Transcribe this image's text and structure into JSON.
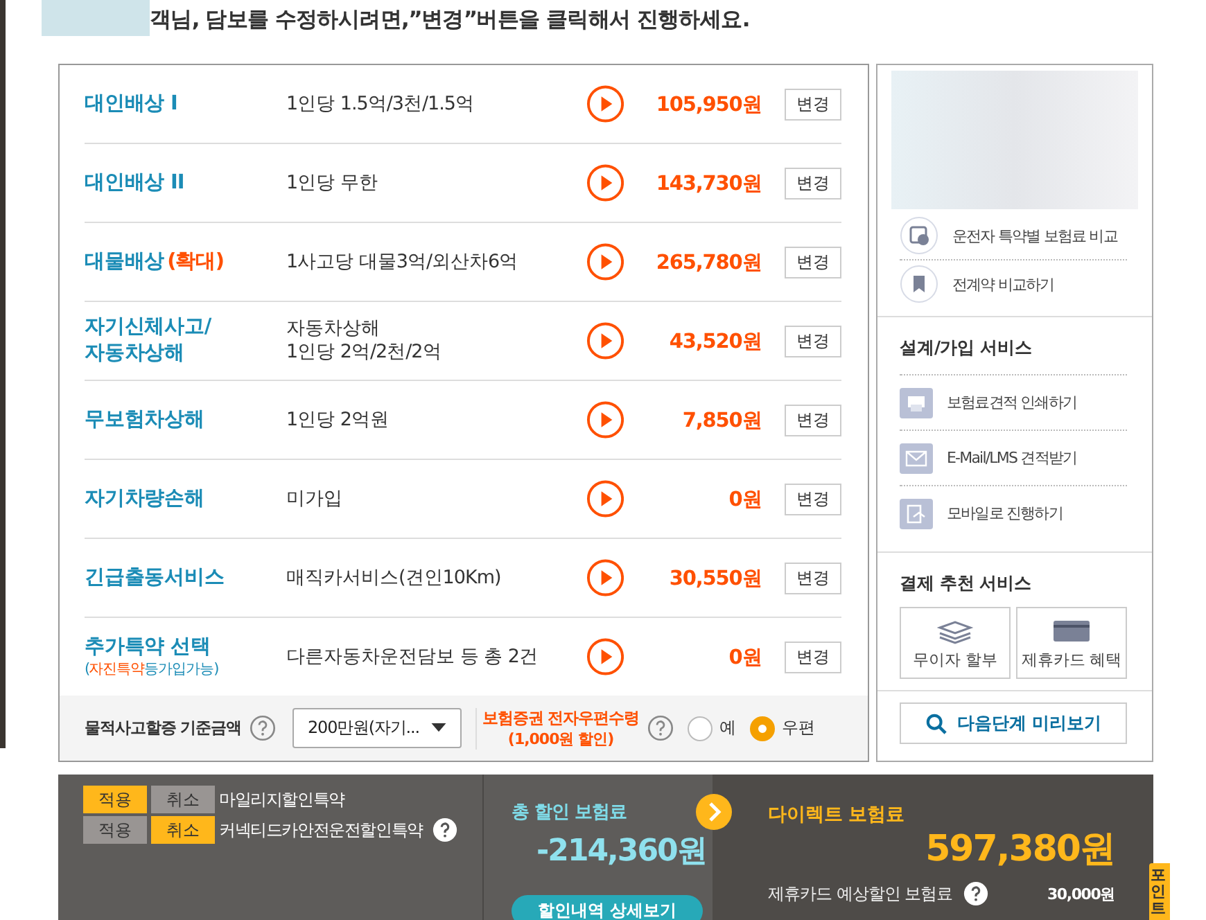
{
  "notice": "객님, 담보를 수정하시려면,”변경”버튼을 클릭해서 진행하세요.",
  "coverages": [
    {
      "label": "대인배상 I",
      "detail": [
        "1인당 1.5억/3천/1.5억"
      ],
      "amount": "105,950원",
      "button": "변경"
    },
    {
      "label": "대인배상 II",
      "detail": [
        "1인당 무한"
      ],
      "amount": "143,730원",
      "button": "변경"
    },
    {
      "label": "대물배상",
      "tag": "(확대)",
      "detail": [
        "1사고당 대물3억/외산차6억"
      ],
      "amount": "265,780원",
      "button": "변경"
    },
    {
      "label": "자기신체사고/\n자동차상해",
      "detail": [
        "자동차상해",
        "1인당 2억/2천/2억"
      ],
      "amount": "43,520원",
      "button": "변경"
    },
    {
      "label": "무보험차상해",
      "detail": [
        "1인당 2억원"
      ],
      "amount": "7,850원",
      "button": "변경"
    },
    {
      "label": "자기차량손해",
      "detail": [
        "미가입"
      ],
      "amount": "0원",
      "button": "변경"
    },
    {
      "label": "긴급출동서비스",
      "detail": [
        "매직카서비스(견인10Km)"
      ],
      "amount": "30,550원",
      "button": "변경"
    },
    {
      "label": "추가특약 선택",
      "note": [
        {
          "kind": "plain",
          "text": "("
        },
        {
          "kind": "highlight",
          "text": "자진특약"
        },
        {
          "kind": "plain",
          "text": "등가입가능)"
        }
      ],
      "detail": [
        "다른자동차운전담보 등 총 2건"
      ],
      "amount": "0원",
      "button": "변경"
    }
  ],
  "options": {
    "property_label": "물적사고할증 기준금액",
    "property_value": "200만원(자기...",
    "certificate_label": "보험증권 전자우편수령",
    "certificate_note": "(1,000원 할인)",
    "radios": [
      {
        "label": "예",
        "selected": false
      },
      {
        "label": "우편",
        "selected": true
      }
    ]
  },
  "sidebar": {
    "links": [
      {
        "kind": "driver",
        "label": "운전자 특약별 보험료 비교"
      },
      {
        "kind": "contract",
        "label": "전계약 비교하기"
      }
    ],
    "design_title": "설계/가입 서비스",
    "services": [
      {
        "kind": "print",
        "label": "보험료견적 인쇄하기"
      },
      {
        "kind": "mail",
        "label": "E-Mail/LMS 견적받기"
      },
      {
        "kind": "mobile",
        "label": "모바일로 진행하기"
      }
    ],
    "payment_title": "결제 추천 서비스",
    "payment": [
      {
        "kind": "installment",
        "label": "무이자 할부"
      },
      {
        "kind": "card",
        "label": "제휴카드 혜택"
      }
    ],
    "preview_button": "다음단계 미리보기"
  },
  "discounts": [
    {
      "apply": "적용",
      "cancel": "취소",
      "applied": true,
      "label": "마일리지할인특약",
      "help": false
    },
    {
      "apply": "적용",
      "cancel": "취소",
      "applied": false,
      "label": "커넥티드카안전운전할인특약",
      "help": true
    }
  ],
  "total_discount": {
    "title": "총 할인 보험료",
    "amount": "-214,360원",
    "button": "할인내역 상세보기"
  },
  "direct": {
    "title": "다이렉트 보험료",
    "amount": "597,380원",
    "lines": [
      {
        "label": "제휴카드 예상할인 보험료",
        "value": "30,000원"
      }
    ]
  },
  "side_tab": "포인트"
}
